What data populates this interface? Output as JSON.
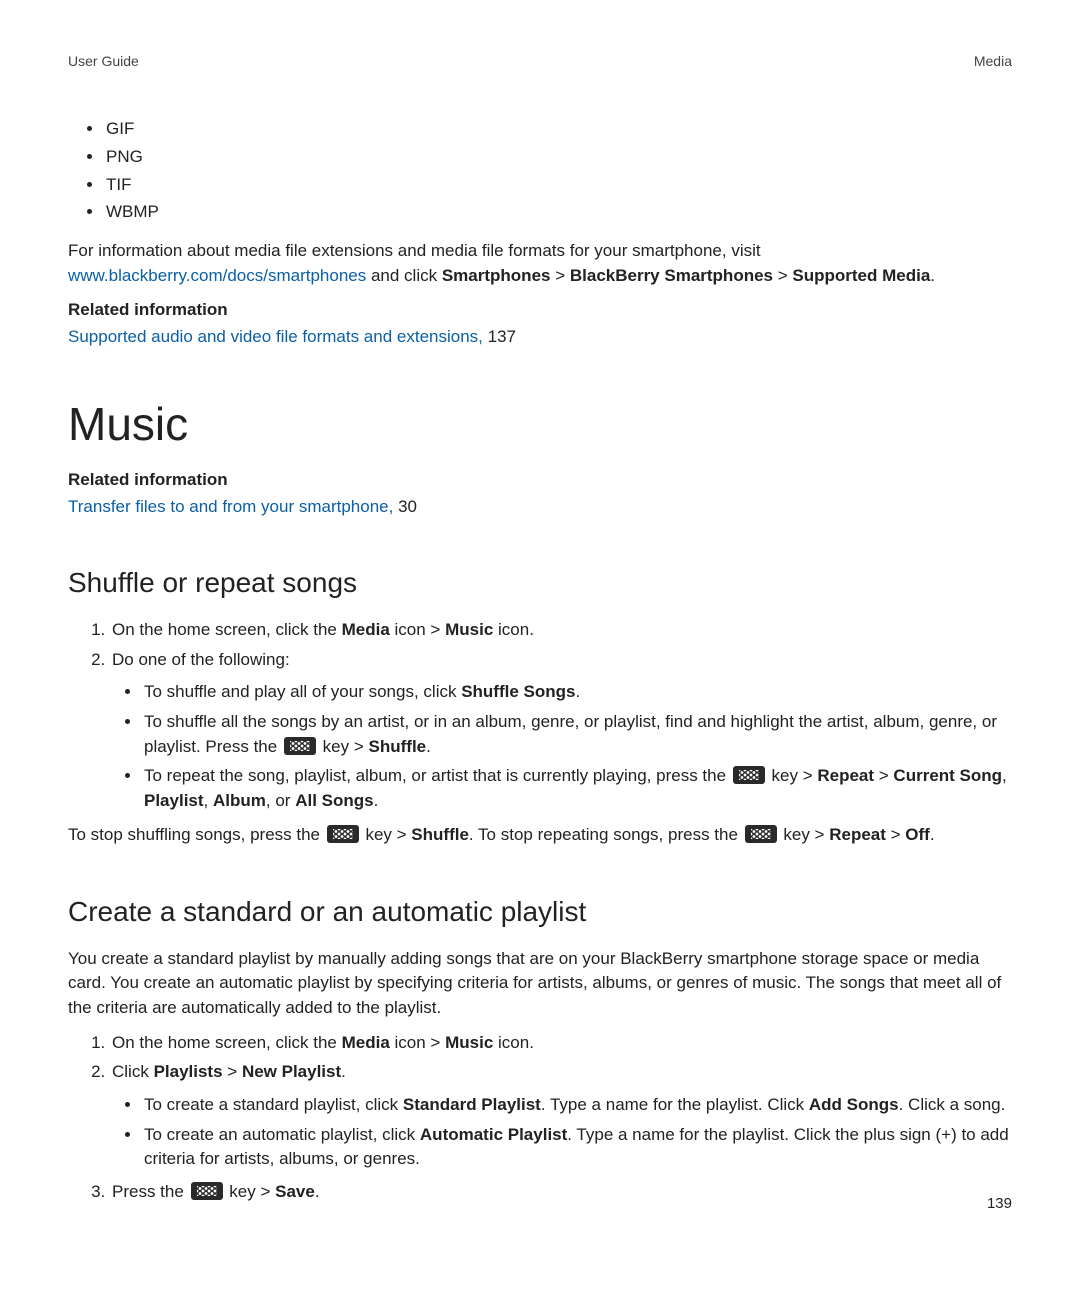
{
  "header": {
    "left": "User Guide",
    "right": "Media"
  },
  "formats": [
    "GIF",
    "PNG",
    "TIF",
    "WBMP"
  ],
  "intro": {
    "pre": "For information about media file extensions and media file formats for your smartphone, visit ",
    "link_text": "www.blackberry.com/docs/smartphones",
    "mid": " and click ",
    "b1": "Smartphones",
    "gt1": " > ",
    "b2": "BlackBerry Smartphones",
    "gt2": " > ",
    "b3": "Supported Media",
    "end": "."
  },
  "related1": {
    "hdr": "Related information",
    "link": "Supported audio and video file formats and extensions,",
    "num": " 137"
  },
  "music_h1": "Music",
  "related2": {
    "hdr": "Related information",
    "link": "Transfer files to and from your smartphone,",
    "num": " 30"
  },
  "shuffle_h2": "Shuffle or repeat songs",
  "step1": {
    "pre": "On the home screen, click the ",
    "b1": "Media",
    "mid": " icon > ",
    "b2": "Music",
    "end": " icon."
  },
  "step2": "Do one of the following:",
  "s_b1": {
    "pre": "To shuffle and play all of your songs, click ",
    "b1": "Shuffle Songs",
    "end": "."
  },
  "s_b2": {
    "pre": "To shuffle all the songs by an artist, or in an album, genre, or playlist, find and highlight the artist, album, genre, or playlist. Press the ",
    "mid": " key > ",
    "b1": "Shuffle",
    "end": "."
  },
  "s_b3": {
    "pre": "To repeat the song, playlist, album, or artist that is currently playing, press the ",
    "mid": " key > ",
    "b1": "Repeat",
    "gt": " > ",
    "b2": "Current Song",
    "c1": ", ",
    "b3": "Playlist",
    "c2": ", ",
    "b4": "Album",
    "c3": ", or ",
    "b5": "All Songs",
    "end": "."
  },
  "stop": {
    "pre": "To stop shuffling songs, press the ",
    "mid1": " key > ",
    "b1": "Shuffle",
    "mid2": ". To stop repeating songs, press the ",
    "mid3": " key > ",
    "b2": "Repeat",
    "gt": " > ",
    "b3": "Off",
    "end": "."
  },
  "playlist_h2": "Create a standard or an automatic playlist",
  "playlist_intro": "You create a standard playlist by manually adding songs that are on your BlackBerry smartphone storage space or media card. You create an automatic playlist by specifying criteria for artists, albums, or genres of music. The songs that meet all of the criteria are automatically added to the playlist.",
  "p_step1": {
    "pre": "On the home screen, click the ",
    "b1": "Media",
    "mid": " icon > ",
    "b2": "Music",
    "end": " icon."
  },
  "p_step2": {
    "pre": "Click ",
    "b1": "Playlists",
    "gt": " > ",
    "b2": "New Playlist",
    "end": "."
  },
  "p_b1": {
    "pre": "To create a standard playlist, click ",
    "b1": "Standard Playlist",
    "mid1": ". Type a name for the playlist. Click ",
    "b2": "Add Songs",
    "end": ". Click a song."
  },
  "p_b2": {
    "pre": "To create an automatic playlist, click ",
    "b1": "Automatic Playlist",
    "end": ". Type a name for the playlist. Click the plus sign (+) to add criteria for artists, albums, or genres."
  },
  "p_step3": {
    "pre": "Press the ",
    "mid": " key > ",
    "b1": "Save",
    "end": "."
  },
  "pagenum": "139"
}
